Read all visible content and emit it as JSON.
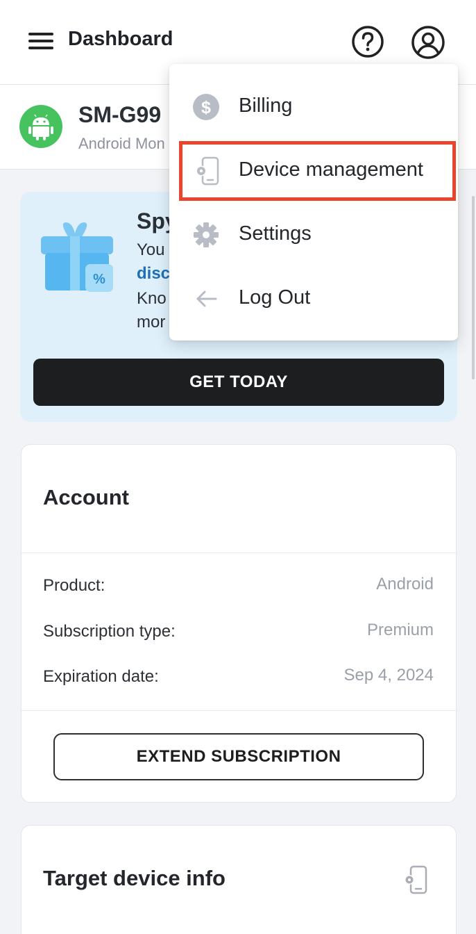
{
  "header": {
    "title": "Dashboard",
    "menu_icon": "hamburger-menu-icon",
    "help_icon": "help-circle-icon",
    "account_icon": "account-circle-icon"
  },
  "device": {
    "model": "SM-G99",
    "subtitle": "Android Mon",
    "avatar_icon": "android-icon",
    "avatar_color": "#46c35f"
  },
  "promo": {
    "title": "Spy",
    "lines": [
      "You",
      "disc",
      "Kno",
      "mor"
    ],
    "cta_label": "GET TODAY",
    "background": "#dff0fb",
    "icon": "gift-icon"
  },
  "account": {
    "title": "Account",
    "rows": [
      {
        "label": "Product:",
        "value": "Android"
      },
      {
        "label": "Subscription type:",
        "value": "Premium"
      },
      {
        "label": "Expiration date:",
        "value": "Sep 4, 2024"
      }
    ],
    "extend_label": "EXTEND SUBSCRIPTION"
  },
  "target_device": {
    "title": "Target device info",
    "icon": "device-settings-icon"
  },
  "dropdown": {
    "items": [
      {
        "label": "Billing",
        "icon": "dollar-circle-icon"
      },
      {
        "label": "Device management",
        "icon": "device-settings-icon",
        "highlighted": true
      },
      {
        "label": "Settings",
        "icon": "gear-icon"
      },
      {
        "label": "Log Out",
        "icon": "arrow-left-icon"
      }
    ],
    "highlight_color": "#e8452c"
  }
}
